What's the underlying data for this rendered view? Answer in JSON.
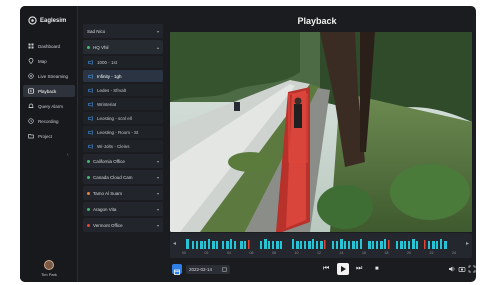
{
  "app": {
    "logo_text": "Eaglesim",
    "page_title": "Playback"
  },
  "nav": {
    "items": [
      {
        "label": "Dashboard",
        "icon": "dashboard-icon",
        "active": false
      },
      {
        "label": "Map",
        "icon": "map-icon",
        "active": false
      },
      {
        "label": "Live Streaming",
        "icon": "live-icon",
        "active": false
      },
      {
        "label": "Playback",
        "icon": "playback-icon",
        "active": true
      },
      {
        "label": "Query Alarm",
        "icon": "alarm-icon",
        "active": false
      },
      {
        "label": "Recording",
        "icon": "recording-icon",
        "active": false
      },
      {
        "label": "Project",
        "icon": "project-icon",
        "active": false
      }
    ],
    "user_name": "Tim Park"
  },
  "panel": {
    "top_group": {
      "label": "Sad Nico",
      "chevron": "▾"
    },
    "section": {
      "label": "HQ Vhil",
      "chevron": "▴"
    },
    "cameras": [
      {
        "label": "1000 - 1st",
        "selected": false
      },
      {
        "label": "Infinity - 1gh",
        "selected": true
      },
      {
        "label": "Ledes - Sfrvalt",
        "selected": false
      },
      {
        "label": "Wrinteriat",
        "selected": false
      },
      {
        "label": "Leosting - scnl ell",
        "selected": false
      },
      {
        "label": "Leosting - Room - St",
        "selected": false
      },
      {
        "label": "Wi-Jolts - Cleins",
        "selected": false
      }
    ],
    "groups": [
      {
        "label": "California Office",
        "color": "#3fb96b"
      },
      {
        "label": "Canada Cloud Cam",
        "color": "#3fb96b"
      },
      {
        "label": "Tamo Al Suam",
        "color": "#e8843a"
      },
      {
        "label": "Aragon Vita",
        "color": "#3fb96b"
      },
      {
        "label": "Vermont Office",
        "color": "#e0453a"
      }
    ]
  },
  "timeline": {
    "ticks": [
      "00",
      "02",
      "04",
      "06",
      "08",
      "10",
      "12",
      "14",
      "16",
      "18",
      "20",
      "22",
      "24"
    ],
    "accent": "#27c4d6"
  },
  "controls": {
    "date": "2022-02-14",
    "prev": "⏮",
    "next": "⏭",
    "stop": "■",
    "volume_icon": "volume-icon",
    "snapshot_icon": "camera-icon",
    "fullscreen_icon": "fullscreen-icon",
    "grid_icon": "grid-icon"
  },
  "colors": {
    "accent_blue": "#2f7fe6",
    "detect_box": "#e0453a"
  }
}
